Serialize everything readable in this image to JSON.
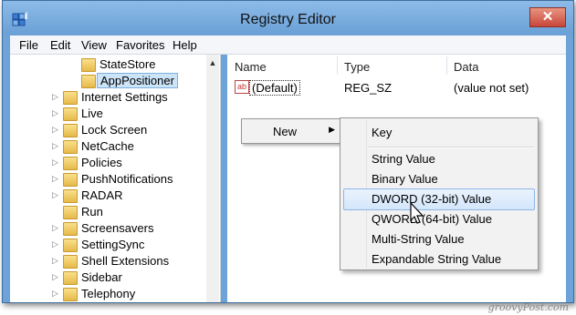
{
  "window": {
    "title": "Registry Editor",
    "close_glyph": "✕"
  },
  "menubar": {
    "items": [
      "File",
      "Edit",
      "View",
      "Favorites",
      "Help"
    ]
  },
  "tree": {
    "items": [
      {
        "label": "StateStore",
        "level": 2
      },
      {
        "label": "AppPositioner",
        "level": 2,
        "selected": true
      },
      {
        "label": "Internet Settings",
        "level": 1
      },
      {
        "label": "Live",
        "level": 1
      },
      {
        "label": "Lock Screen",
        "level": 1
      },
      {
        "label": "NetCache",
        "level": 1
      },
      {
        "label": "Policies",
        "level": 1
      },
      {
        "label": "PushNotifications",
        "level": 1
      },
      {
        "label": "RADAR",
        "level": 1
      },
      {
        "label": "Run",
        "level": 1
      },
      {
        "label": "Screensavers",
        "level": 1
      },
      {
        "label": "SettingSync",
        "level": 1
      },
      {
        "label": "Shell Extensions",
        "level": 1
      },
      {
        "label": "Sidebar",
        "level": 1
      },
      {
        "label": "Telephony",
        "level": 1
      }
    ]
  },
  "list": {
    "columns": [
      "Name",
      "Type",
      "Data"
    ],
    "rows": [
      {
        "name": "(Default)",
        "type": "REG_SZ",
        "data": "(value not set)",
        "icon": "ab"
      }
    ]
  },
  "context_menu": {
    "new_label": "New",
    "arrow": "▶"
  },
  "submenu": {
    "items": [
      "Key",
      "String Value",
      "Binary Value",
      "DWORD (32-bit) Value",
      "QWORD (64-bit) Value",
      "Multi-String Value",
      "Expandable String Value"
    ],
    "highlighted_index": 3
  },
  "watermark": "groovyPost.com",
  "colors": {
    "title_bar": "#6da3d8",
    "selection": "#cce4f7",
    "highlight_border": "#8fb5e6"
  }
}
